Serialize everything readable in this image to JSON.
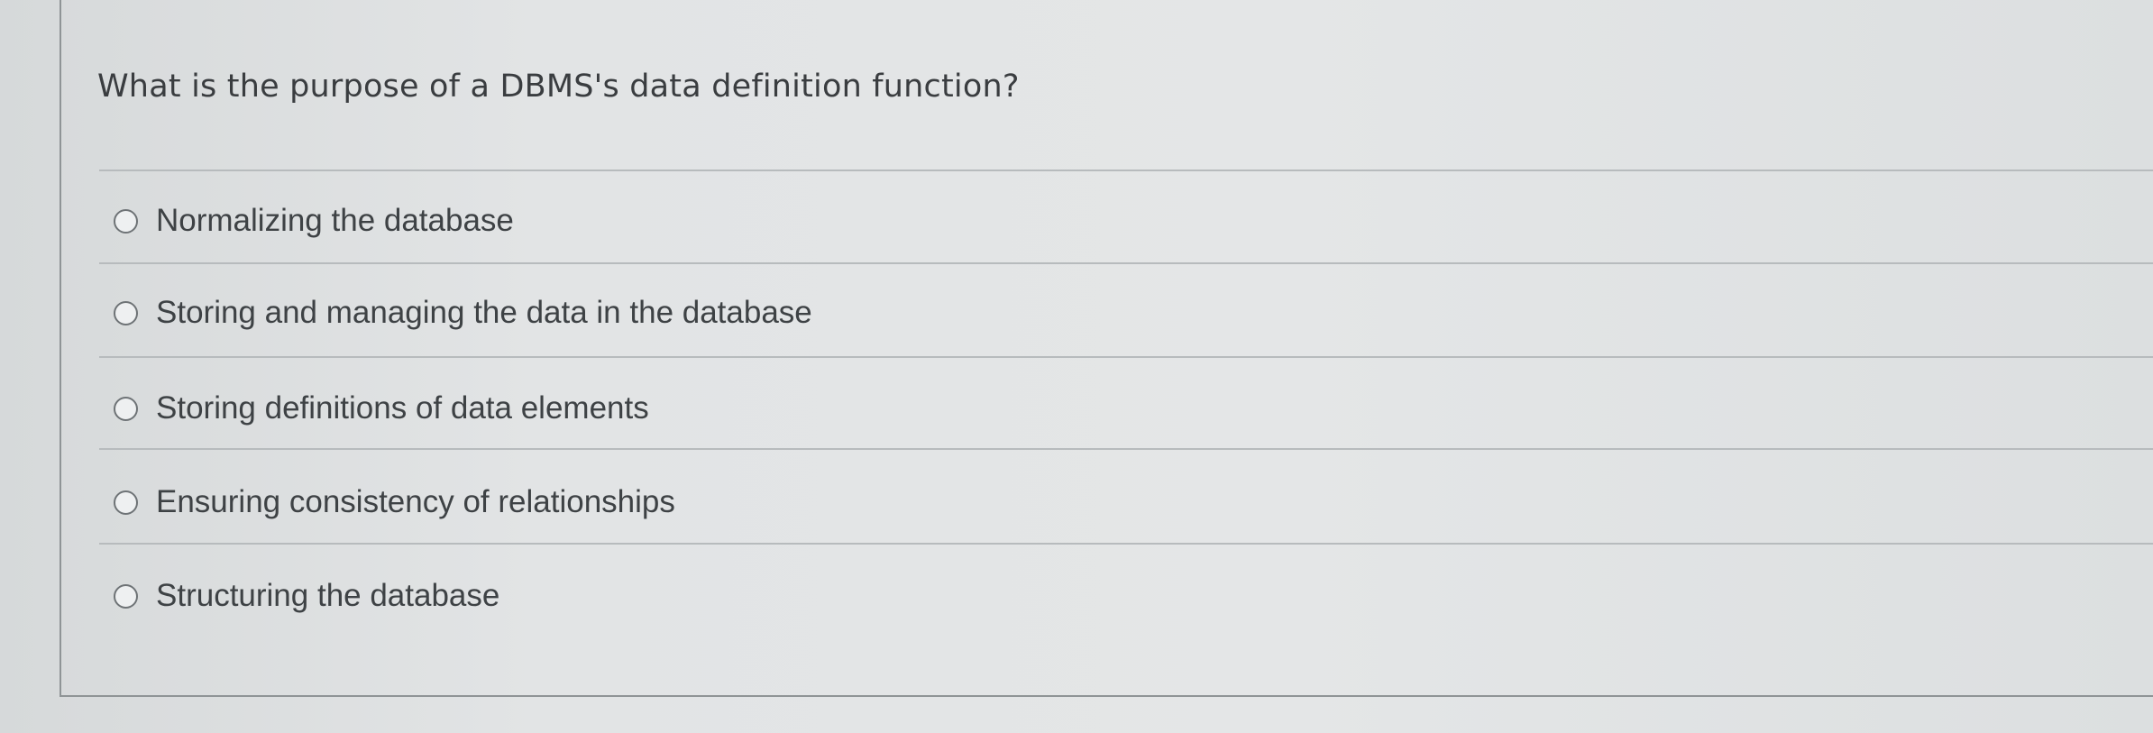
{
  "question": {
    "text": "What is the purpose of a DBMS's data definition function?"
  },
  "options": [
    {
      "label": "Normalizing the database",
      "selected": false
    },
    {
      "label": "Storing and managing the data in the database",
      "selected": false
    },
    {
      "label": "Storing definitions of data elements",
      "selected": false
    },
    {
      "label": "Ensuring consistency of relationships",
      "selected": false
    },
    {
      "label": "Structuring the database",
      "selected": false
    }
  ]
}
